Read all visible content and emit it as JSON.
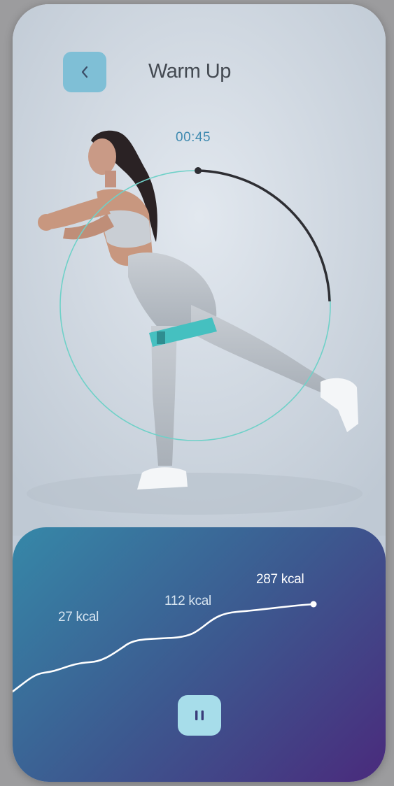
{
  "header": {
    "title": "Warm Up",
    "back_icon": "chevron-left-icon"
  },
  "workout": {
    "timer": "00:45",
    "progress_fraction": 0.3
  },
  "calories": {
    "labels": [
      "27 kcal",
      "112 kcal",
      "287 kcal"
    ]
  },
  "controls": {
    "pause_icon": "pause-icon"
  },
  "colors": {
    "accent": "#7fbfd6",
    "ring": "#6fd1c8",
    "progress": "#2e2e33",
    "panel_start": "#3688a8",
    "panel_end": "#4a2a7c"
  }
}
